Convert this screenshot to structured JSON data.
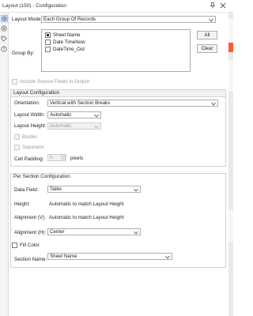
{
  "window": {
    "title": "Layout (150) - Configuration"
  },
  "layout_mode": {
    "label": "Layout Mode:",
    "value": "Each Group Of Records"
  },
  "group_by": {
    "label": "Group By:",
    "items": [
      {
        "label": "Sheet Name",
        "checked": true
      },
      {
        "label": "Date TimeNow",
        "checked": false
      },
      {
        "label": "DateTime_Out",
        "checked": false
      }
    ],
    "all_button": "All",
    "clear_button": "Clear"
  },
  "include_source": {
    "label": "Include Source Fields in Output",
    "checked": false
  },
  "layout_config": {
    "header": "Layout Configuration",
    "orientation": {
      "label": "Orientation:",
      "value": "Vertical with Section Breaks"
    },
    "layout_width": {
      "label": "Layout Width:",
      "value": "Automatic"
    },
    "layout_height": {
      "label": "Layout Height:",
      "value": "Automatic"
    },
    "border": {
      "label": "Border",
      "checked": false
    },
    "separator": {
      "label": "Separator",
      "checked": false
    },
    "cell_padding": {
      "label": "Cell Padding:",
      "value": "0",
      "unit": "pixels"
    }
  },
  "per_section": {
    "header": "Per Section Configuration",
    "data_field": {
      "label": "Data Field:",
      "value": "Table"
    },
    "height": {
      "label": "Height:",
      "value": "Automatic to match Layout Height"
    },
    "alignment_v": {
      "label": "Alignment (V):",
      "value": "Automatic to match Layout Height"
    },
    "alignment_h": {
      "label": "Alignment (H):",
      "value": "Center"
    },
    "fill_color": {
      "label": "Fill Color",
      "checked": false
    },
    "section_name": {
      "label": "Section Name:",
      "value": "Sheet Name"
    }
  },
  "colors": {
    "accent": "#cfe3f7",
    "highlight_strip": "#ff5a32",
    "disabled_text": "#9a9a9a"
  },
  "icons": [
    "pin-icon",
    "close-icon",
    "config-icon",
    "wrench-icon",
    "tag-icon",
    "help-icon",
    "dropdown-caret-icon"
  ]
}
